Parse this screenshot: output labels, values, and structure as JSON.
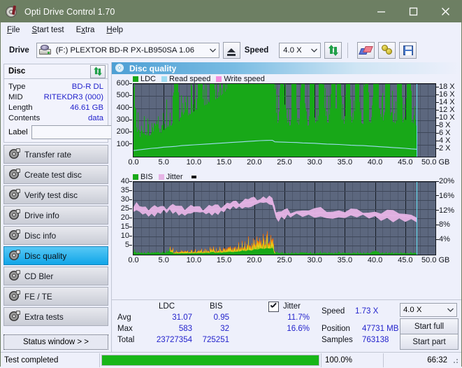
{
  "window": {
    "title": "Opti Drive Control 1.70",
    "icon": "disc-icon",
    "minimize": "minimize",
    "maximize": "maximize",
    "close": "close"
  },
  "menu": {
    "items": [
      "File",
      "Start test",
      "Extra",
      "Help"
    ]
  },
  "toolbar": {
    "drive_label": "Drive",
    "drive_value": "(F:)  PLEXTOR BD-R  PX-LB950SA 1.06",
    "eject_icon": "eject-icon",
    "speed_label": "Speed",
    "speed_value": "4.0 X",
    "refresh_icon": "refresh-icon",
    "erase_icon": "erase-icon",
    "bulb_icon": "bulb-icon",
    "save_icon": "save-icon"
  },
  "disc_panel": {
    "title": "Disc",
    "refresh_icon": "refresh-icon",
    "rows": [
      {
        "key": "Type",
        "value": "BD-R DL"
      },
      {
        "key": "MID",
        "value": "RITEKDR3 (000)"
      },
      {
        "key": "Length",
        "value": "46.61 GB"
      },
      {
        "key": "Contents",
        "value": "data"
      }
    ],
    "label_key": "Label",
    "label_value": "",
    "label_placeholder": "",
    "label_button_icon": "cd-icon"
  },
  "sidebar": {
    "items": [
      {
        "label": "Transfer rate",
        "active": false
      },
      {
        "label": "Create test disc",
        "active": false
      },
      {
        "label": "Verify test disc",
        "active": false
      },
      {
        "label": "Drive info",
        "active": false
      },
      {
        "label": "Disc info",
        "active": false
      },
      {
        "label": "Disc quality",
        "active": true
      },
      {
        "label": "CD Bler",
        "active": false
      },
      {
        "label": "FE / TE",
        "active": false
      },
      {
        "label": "Extra tests",
        "active": false
      }
    ],
    "status_window": "Status window > >"
  },
  "content": {
    "header_title": "Disc quality",
    "header_icon": "disc-quality-icon"
  },
  "chart_data": [
    {
      "type": "area",
      "title": "LDC / Read speed",
      "xlabel": "GB",
      "ylabel": "",
      "xlim": [
        0,
        50
      ],
      "ylim": [
        0,
        600
      ],
      "y2lim": [
        0,
        19
      ],
      "grid": true,
      "legend": [
        "LDC",
        "Read speed",
        "Write speed"
      ],
      "legend_colors": [
        "#18a818",
        "#9fdcf2",
        "#f58edd"
      ],
      "xticks": [
        "0.0",
        "5.0",
        "10.0",
        "15.0",
        "20.0",
        "25.0",
        "30.0",
        "35.0",
        "40.0",
        "45.0",
        "50.0"
      ],
      "yticks": [
        "100",
        "200",
        "300",
        "400",
        "500",
        "600"
      ],
      "y2ticks": [
        "2 X",
        "4 X",
        "6 X",
        "8 X",
        "10 X",
        "12 X",
        "14 X",
        "16 X",
        "18 X"
      ],
      "cursor_x": 46.9,
      "series": [
        {
          "name": "LDC",
          "color": "#18a818",
          "x": [
            0.0,
            0.5,
            1.0,
            1.5,
            2.0,
            2.5,
            3.0,
            3.5,
            4.0,
            4.5,
            5.0,
            5.5,
            6.0,
            6.5,
            7.0,
            7.5,
            8.0,
            8.5,
            9.0,
            9.5,
            10.0,
            10.5,
            11.0,
            11.5,
            12.0,
            12.5,
            13.0,
            13.5,
            14.0,
            14.5,
            15.0,
            15.5,
            16.0,
            16.5,
            17.0,
            17.5,
            18.0,
            18.5,
            19.0,
            19.5,
            20.0,
            20.5,
            21.0,
            21.5,
            22.0,
            22.5,
            23.0,
            23.3,
            23.6,
            24.0,
            24.5,
            25.0,
            25.5,
            26.0,
            26.5,
            27.0,
            27.5,
            28.0,
            28.5,
            29.0,
            29.5,
            30.0,
            30.5,
            31.0,
            31.5,
            32.0,
            32.5,
            33.0,
            33.5,
            34.0,
            34.5,
            35.0,
            35.5,
            36.0,
            36.5,
            37.0,
            37.5,
            38.0,
            38.5,
            39.0,
            39.5,
            40.0,
            40.5,
            41.0,
            41.5,
            42.0,
            42.5,
            43.0,
            43.5,
            44.0,
            44.5,
            45.0,
            45.5,
            46.0,
            46.5,
            46.9
          ],
          "values": [
            160,
            60,
            45,
            55,
            50,
            48,
            52,
            60,
            58,
            55,
            62,
            68,
            70,
            75,
            450,
            80,
            88,
            92,
            95,
            100,
            105,
            110,
            300,
            118,
            120,
            125,
            290,
            132,
            136,
            142,
            148,
            155,
            300,
            170,
            180,
            200,
            220,
            250,
            280,
            330,
            380,
            420,
            470,
            520,
            560,
            500,
            520,
            180,
            90,
            70,
            300,
            120,
            75,
            70,
            250,
            80,
            70,
            230,
            75,
            70,
            300,
            80,
            70,
            290,
            120,
            80,
            75,
            300,
            80,
            320,
            80,
            70,
            300,
            80,
            75,
            280,
            80,
            75,
            300,
            80,
            75,
            310,
            120,
            90,
            80,
            300,
            85,
            80,
            75,
            280,
            80,
            75,
            290,
            80,
            75,
            70
          ]
        },
        {
          "name": "Read speed",
          "color": "#9fdcf2",
          "x": [
            0.0,
            1.0,
            2.0,
            3.0,
            4.0,
            5.0,
            6.0,
            7.0,
            8.0,
            9.0,
            10.0,
            11.0,
            12.0,
            13.0,
            14.0,
            15.0,
            16.0,
            17.0,
            18.0,
            19.0,
            20.0,
            21.0,
            22.0,
            23.0,
            23.4,
            24.0,
            25.0,
            26.0,
            27.0,
            28.0,
            29.0,
            30.0,
            31.0,
            32.0,
            33.0,
            34.0,
            35.0,
            36.0,
            37.0,
            38.0,
            39.0,
            40.0,
            41.0,
            42.0,
            43.0,
            44.0,
            45.0,
            46.0,
            46.9
          ],
          "values": [
            1.6,
            1.8,
            2.0,
            2.2,
            2.3,
            2.5,
            2.6,
            2.7,
            2.9,
            3.0,
            3.1,
            3.2,
            3.3,
            3.4,
            3.5,
            3.6,
            3.7,
            3.8,
            3.9,
            4.0,
            4.1,
            4.2,
            4.25,
            4.3,
            3.9,
            3.85,
            3.8,
            3.75,
            3.7,
            3.6,
            3.55,
            3.5,
            3.4,
            3.3,
            3.25,
            3.2,
            3.1,
            3.0,
            2.95,
            2.9,
            2.8,
            2.7,
            2.6,
            2.5,
            2.4,
            2.3,
            2.2,
            2.05,
            1.95
          ]
        },
        {
          "name": "Write speed",
          "color": "#f58edd",
          "x": [],
          "values": []
        }
      ]
    },
    {
      "type": "area",
      "title": "BIS / Jitter",
      "xlabel": "GB",
      "ylabel": "",
      "xlim": [
        0,
        50
      ],
      "ylim": [
        0,
        40
      ],
      "y2lim": [
        0,
        20
      ],
      "grid": true,
      "legend": [
        "BIS",
        "Jitter"
      ],
      "legend_colors": [
        "#18a818",
        "#e6b4e6"
      ],
      "xticks": [
        "0.0",
        "5.0",
        "10.0",
        "15.0",
        "20.0",
        "25.0",
        "30.0",
        "35.0",
        "40.0",
        "45.0",
        "50.0"
      ],
      "yticks": [
        "5",
        "10",
        "15",
        "20",
        "25",
        "30",
        "35",
        "40"
      ],
      "y2ticks": [
        "4%",
        "8%",
        "12%",
        "16%",
        "20%"
      ],
      "cursor_x": 46.9,
      "series": [
        {
          "name": "BIS",
          "color": "#18a818",
          "x": [
            0.0,
            0.5,
            1.0,
            1.5,
            2.0,
            2.5,
            3.0,
            3.5,
            4.0,
            4.5,
            5.0,
            5.5,
            6.0,
            6.3,
            6.6,
            7.0,
            7.5,
            8.0,
            8.5,
            9.0,
            9.5,
            10.0,
            10.5,
            11.0,
            11.5,
            12.0,
            12.5,
            13.0,
            13.5,
            14.0,
            14.5,
            15.0,
            15.5,
            16.0,
            16.5,
            17.0,
            17.5,
            18.0,
            18.5,
            19.0,
            19.5,
            20.0,
            20.5,
            21.0,
            21.5,
            22.0,
            22.5,
            23.0,
            23.2,
            23.4,
            24.0,
            25.0,
            26.0,
            27.0,
            28.0,
            29.0,
            30.0,
            31.0,
            32.0,
            33.0,
            34.0,
            35.0,
            36.0,
            37.0,
            38.0,
            39.0,
            40.0,
            41.0,
            42.0,
            43.0,
            44.0,
            45.0,
            46.0,
            46.9
          ],
          "values": [
            9,
            4,
            3.5,
            4,
            3.5,
            4,
            3.8,
            4,
            4.2,
            4,
            4.5,
            5,
            13,
            12,
            6,
            5.5,
            6,
            6.5,
            6,
            7,
            6.5,
            7,
            7.5,
            8,
            7.5,
            9,
            8.5,
            13,
            9,
            10,
            9.5,
            11,
            12,
            13,
            12,
            14,
            15,
            20,
            17,
            22,
            19,
            26,
            24,
            30,
            27,
            31,
            29,
            32,
            10,
            5,
            4,
            3,
            3.2,
            3,
            4,
            3.5,
            3,
            4,
            3.5,
            3,
            4,
            3.2,
            3,
            3.5,
            3,
            3.2,
            7,
            3,
            3.5,
            3,
            3.2,
            3,
            3.5,
            3
          ]
        },
        {
          "name": "Jitter",
          "color": "#e6b4e6",
          "x": [
            0.0,
            0.5,
            1.0,
            1.5,
            2.0,
            2.5,
            3.0,
            3.5,
            4.0,
            4.5,
            5.0,
            5.5,
            6.0,
            6.5,
            7.0,
            7.5,
            8.0,
            8.5,
            9.0,
            9.5,
            10.0,
            10.5,
            11.0,
            11.5,
            12.0,
            12.5,
            13.0,
            13.5,
            14.0,
            14.5,
            15.0,
            15.5,
            16.0,
            16.5,
            17.0,
            17.5,
            18.0,
            18.5,
            19.0,
            19.5,
            20.0,
            20.5,
            21.0,
            21.5,
            22.0,
            22.5,
            23.0,
            23.3,
            23.6,
            24.0,
            24.5,
            25.0,
            25.5,
            26.0,
            27.0,
            28.0,
            29.0,
            30.0,
            31.0,
            32.0,
            33.0,
            34.0,
            35.0,
            36.0,
            37.0,
            38.0,
            39.0,
            40.0,
            41.0,
            42.0,
            43.0,
            44.0,
            45.0,
            46.0,
            46.9
          ],
          "values": [
            12.2,
            12.8,
            12.4,
            12.2,
            12.3,
            12.1,
            12.2,
            12.0,
            12.1,
            12.3,
            12.4,
            12.3,
            12.6,
            12.4,
            12.5,
            12.3,
            12.4,
            12.2,
            12.3,
            12.2,
            12.3,
            12.1,
            12.2,
            12.1,
            12.2,
            12.3,
            12.4,
            12.5,
            12.6,
            12.7,
            12.9,
            13.0,
            13.2,
            13.4,
            13.6,
            13.8,
            14.0,
            14.2,
            14.4,
            14.3,
            14.6,
            14.8,
            14.7,
            14.9,
            14.6,
            14.8,
            14.2,
            13.5,
            11.0,
            10.8,
            11.2,
            11.0,
            11.3,
            11.1,
            11.4,
            11.2,
            11.5,
            11.3,
            11.6,
            11.4,
            11.2,
            11.3,
            11.1,
            11.2,
            11.0,
            11.1,
            10.9,
            11.0,
            10.8,
            10.9,
            10.7,
            10.8,
            10.5,
            10.2,
            9.8
          ]
        }
      ]
    }
  ],
  "stats": {
    "col_ldc": "LDC",
    "col_bis": "BIS",
    "jitter_label": "Jitter",
    "jitter_checked": true,
    "rows": [
      {
        "key": "Avg",
        "ldc": "31.07",
        "bis": "0.95",
        "jitter": "11.7%"
      },
      {
        "key": "Max",
        "ldc": "583",
        "bis": "32",
        "jitter": "16.6%"
      },
      {
        "key": "Total",
        "ldc": "23727354",
        "bis": "725251",
        "jitter": ""
      }
    ],
    "speed_label": "Speed",
    "speed_value": "1.73 X",
    "position_label": "Position",
    "position_value": "47731 MB",
    "samples_label": "Samples",
    "samples_value": "763138",
    "speed_select": "4.0 X",
    "start_full": "Start full",
    "start_part": "Start part"
  },
  "statusbar": {
    "message": "Test completed",
    "progress_percent": 100.0,
    "progress_text": "100.0%",
    "elapsed": "66:32"
  }
}
